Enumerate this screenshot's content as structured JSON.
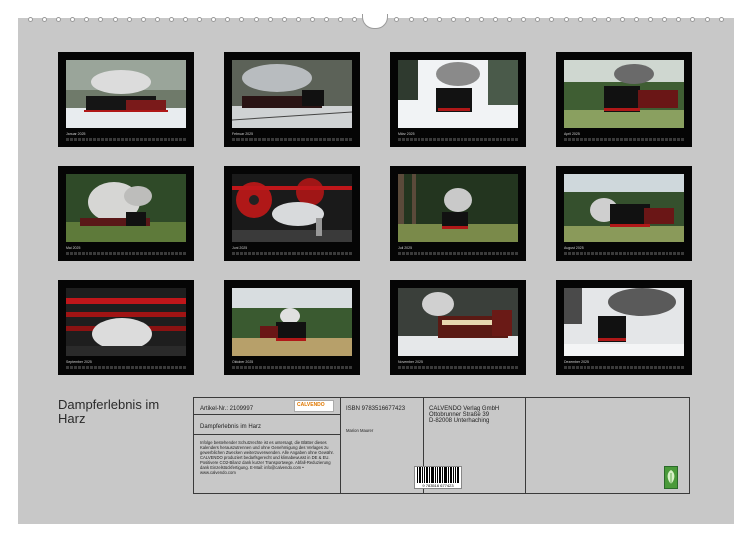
{
  "title": "Dampferlebnis im Harz",
  "months": [
    "Januar 2025",
    "Februar 2025",
    "März 2025",
    "April 2025",
    "Mai 2025",
    "Juni 2025",
    "Juli 2025",
    "August 2025",
    "September 2025",
    "Oktober 2025",
    "November 2025",
    "Dezember 2025"
  ],
  "info": {
    "article": "Artikel-Nr.: 2109997",
    "logo_text": "CALVENDO",
    "calendar_title": "Dampferlebnis im Harz",
    "legal": "Infolge bestehender Schutzrechte ist es untersagt, die Blätter dieses Kalenders herauszutrennen und ohne Genehmigung des Verlages zu gewerblichen Zwecken weiterzuverwenden. Alle Angaben ohne Gewähr. CALVENDO produziert bedarfsgerecht und klimabewusst in DE & EU. Positivere CO2-Bilanz dank kurzer Transportwege. Abfall-Reduzierung dank Einzelstückfertigung. E-Mail: info@calvendo.com • www.calvendo.com",
    "isbn": "ISBN 9783516677423",
    "author": "Marion Maurer",
    "publisher_1": "CALVENDO Verlag GmbH",
    "publisher_2": "Ottobrunner Straße 39",
    "publisher_3": "D-82008 Unterhaching",
    "barcode_digits": "9 783516 677423"
  },
  "colors": {
    "sheet": "#c8c8c8",
    "tile": "#050505",
    "rail_red": "#c0161a"
  }
}
